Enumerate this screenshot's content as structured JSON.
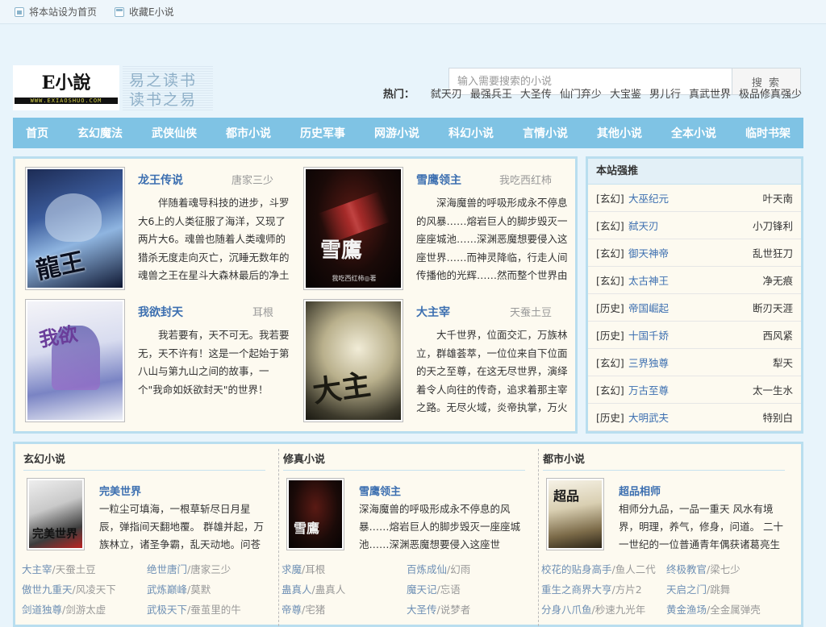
{
  "topbar": {
    "set_home": "将本站设为首页",
    "bookmark": "收藏E小说"
  },
  "logo": {
    "title": "E小說",
    "url": "WWW.EXIAOSHUO.COM",
    "slogan1": "易之读书",
    "slogan2": "读书之易"
  },
  "search": {
    "placeholder": "输入需要搜索的小说",
    "button": "搜 索"
  },
  "hot": {
    "label": "热门：",
    "items": [
      "弑天刃",
      "最强兵王",
      "大圣传",
      "仙门弃少",
      "大宝鉴",
      "男儿行",
      "真武世界",
      "极品修真强少"
    ]
  },
  "nav": [
    "首页",
    "玄幻魔法",
    "武侠仙侠",
    "都市小说",
    "历史军事",
    "网游小说",
    "科幻小说",
    "言情小说",
    "其他小说",
    "全本小说",
    "临时书架"
  ],
  "featured": [
    {
      "title": "龙王传说",
      "author": "唐家三少",
      "desc": "伴随着魂导科技的进步，斗罗大6上的人类征服了海洋，又现了两片大6。魂兽也随着人类魂师的猎杀无度走向灭亡，沉睡无数年的魂兽之王在星斗大森林最后的净土苏醒，它要带领仅存的族人，向人类"
    },
    {
      "title": "雪鹰领主",
      "author": "我吃西红柿",
      "desc": "深海魔兽的呼吸形成永不停息的风暴……熔岩巨人的脚步毁灭一座座城池……深渊恶魔想要侵入这座世界……而神灵降临，行走人间传播他的光辉……然而整个世界由夏族帝国'龙山帝国'统治，这是人类"
    },
    {
      "title": "我欲封天",
      "author": "耳根",
      "desc": "我若要有，天不可无。我若要无，天不许有！这是一个起始于第八山与第九山之间的故事，一个\"我命如妖欲封天\"的世界！"
    },
    {
      "title": "大主宰",
      "author": "天蚕土豆",
      "desc": "大千世界，位面交汇，万族林立，群雄荟萃，一位位来自下位面的天之至尊，在这无尽世界，演绎着令人向往的传奇，追求着那主宰之路。无尽火域，炎帝执掌，万火焚苍穹。 武境之内，武祖之威，震"
    }
  ],
  "recommend": {
    "title": "本站强推",
    "rows": [
      {
        "cat": "[玄幻]",
        "book": "大巫纪元",
        "author": "叶天南"
      },
      {
        "cat": "[玄幻]",
        "book": "弑天刃",
        "author": "小刀锋利"
      },
      {
        "cat": "[玄幻]",
        "book": "御天神帝",
        "author": "乱世狂刀"
      },
      {
        "cat": "[玄幻]",
        "book": "太古神王",
        "author": "净无痕"
      },
      {
        "cat": "[历史]",
        "book": "帝国崛起",
        "author": "断刃天涯"
      },
      {
        "cat": "[历史]",
        "book": "十国千娇",
        "author": "西风紧"
      },
      {
        "cat": "[玄幻]",
        "book": "三界独尊",
        "author": "犁天"
      },
      {
        "cat": "[玄幻]",
        "book": "万古至尊",
        "author": "太一生水"
      },
      {
        "cat": "[历史]",
        "book": "大明武夫",
        "author": "特别白"
      }
    ]
  },
  "columns": [
    {
      "title": "玄幻小说",
      "feature_title": "完美世界",
      "feature_desc": "一粒尘可填海，一根草斩尽日月星辰，弹指间天翻地覆。 群雄并起，万族林立，诸圣争霸，乱天动地。问苍茫大地，谁主沉",
      "links": [
        [
          {
            "book": "大主宰",
            "author": "/天蚕土豆"
          },
          {
            "book": "绝世唐门",
            "author": "/唐家三少"
          }
        ],
        [
          {
            "book": "傲世九重天",
            "author": "/风凌天下"
          },
          {
            "book": "武炼巅峰",
            "author": "/莫默"
          }
        ],
        [
          {
            "book": "剑道独尊",
            "author": "/剑游太虚"
          },
          {
            "book": "武极天下",
            "author": "/蚕茧里的牛"
          }
        ]
      ]
    },
    {
      "title": "修真小说",
      "feature_title": "雪鹰领主",
      "feature_desc": "深海魔兽的呼吸形成永不停息的风暴……熔岩巨人的脚步毁灭一座座城池……深渊恶魔想要侵入这座世界……而神灵降临，",
      "links": [
        [
          {
            "book": "求魔",
            "author": "/耳根"
          },
          {
            "book": "百炼成仙",
            "author": "/幻雨"
          }
        ],
        [
          {
            "book": "蛊真人",
            "author": "/蛊真人"
          },
          {
            "book": "魔天记",
            "author": "/忘语"
          }
        ],
        [
          {
            "book": "帝尊",
            "author": "/宅猪"
          },
          {
            "book": "大圣传",
            "author": "/说梦者"
          }
        ]
      ]
    },
    {
      "title": "都市小说",
      "feature_title": "超品相师",
      "feature_desc": "相师分九品，一品一重天 风水有境界，明理，养气，修身，问道。 二十一世纪的一位普通青年偶获诸葛亮生前的玄学传承，",
      "links": [
        [
          {
            "book": "校花的贴身高手",
            "author": "/鱼人二代"
          },
          {
            "book": "终极教官",
            "author": "/梁七少"
          }
        ],
        [
          {
            "book": "重生之商界大亨",
            "author": "/方片2"
          },
          {
            "book": "天启之门",
            "author": "/跳舞"
          }
        ],
        [
          {
            "book": "分身八爪鱼",
            "author": "/秒速九光年"
          },
          {
            "book": "黄金渔场",
            "author": "/全金属弹壳"
          }
        ]
      ]
    }
  ]
}
